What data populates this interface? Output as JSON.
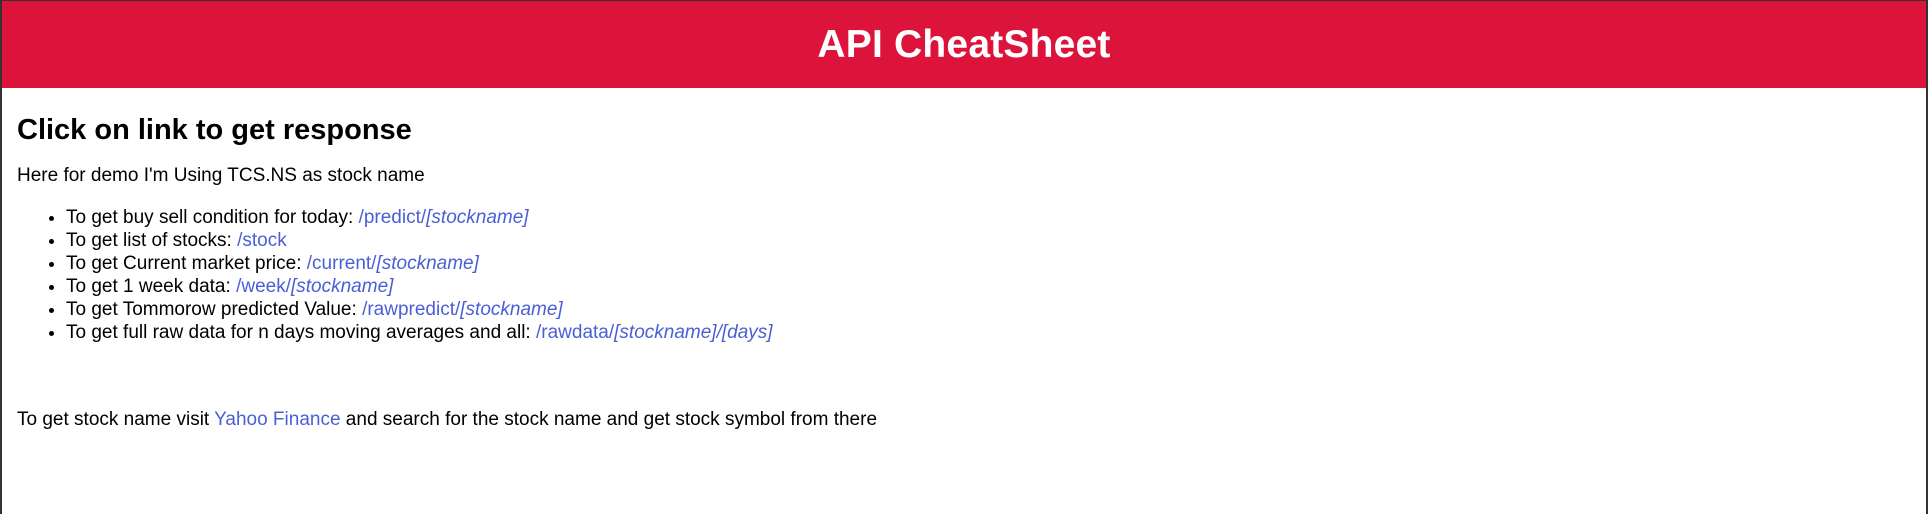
{
  "header": {
    "title": "API CheatSheet",
    "background_color": "#dc143c"
  },
  "main": {
    "heading": "Click on link to get response",
    "intro": "Here for demo I'm Using TCS.NS as stock name",
    "endpoints": [
      {
        "text": "To get buy sell condition for today: ",
        "path": "/predict/",
        "param": "[stockname]"
      },
      {
        "text": "To get list of stocks: ",
        "path": "/stock",
        "param": ""
      },
      {
        "text": "To get Current market price: ",
        "path": "/current/",
        "param": "[stockname]"
      },
      {
        "text": "To get 1 week data: ",
        "path": "/week/",
        "param": "[stockname]"
      },
      {
        "text": "To get Tommorow predicted Value: ",
        "path": "/rawpredict/",
        "param": "[stockname]"
      },
      {
        "text": "To get full raw data for n days moving averages and all: ",
        "path": "/rawdata/",
        "param": "[stockname]/[days]"
      }
    ],
    "footer": {
      "before": "To get stock name visit ",
      "link": "Yahoo Finance",
      "after": " and search for the stock name and get stock symbol from there"
    },
    "link_color": "#4a5fd6"
  }
}
